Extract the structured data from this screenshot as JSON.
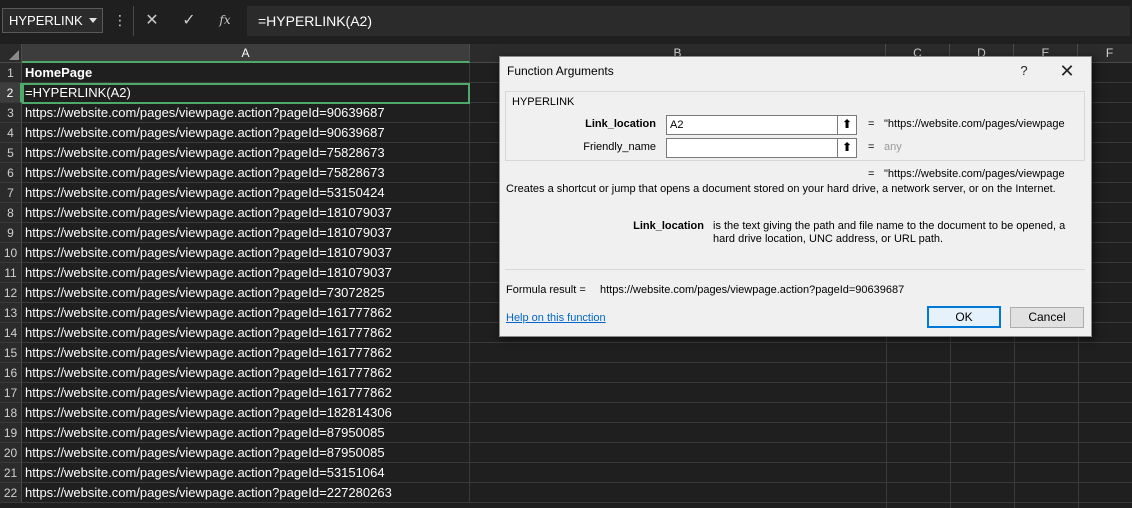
{
  "formula_bar": {
    "name_box": "HYPERLINK",
    "cancel_icon": "✕",
    "enter_icon": "✓",
    "fx_label": "fx",
    "formula": "=HYPERLINK(A2)"
  },
  "columns": [
    "A",
    "B",
    "C",
    "D",
    "E",
    "F"
  ],
  "rows": [
    {
      "num": "1",
      "a": "HomePage"
    },
    {
      "num": "2",
      "a": "=HYPERLINK(A2)"
    },
    {
      "num": "3",
      "a": "https://website.com/pages/viewpage.action?pageId=90639687"
    },
    {
      "num": "4",
      "a": "https://website.com/pages/viewpage.action?pageId=90639687"
    },
    {
      "num": "5",
      "a": "https://website.com/pages/viewpage.action?pageId=75828673"
    },
    {
      "num": "6",
      "a": "https://website.com/pages/viewpage.action?pageId=75828673"
    },
    {
      "num": "7",
      "a": "https://website.com/pages/viewpage.action?pageId=53150424"
    },
    {
      "num": "8",
      "a": "https://website.com/pages/viewpage.action?pageId=181079037"
    },
    {
      "num": "9",
      "a": "https://website.com/pages/viewpage.action?pageId=181079037"
    },
    {
      "num": "10",
      "a": "https://website.com/pages/viewpage.action?pageId=181079037"
    },
    {
      "num": "11",
      "a": "https://website.com/pages/viewpage.action?pageId=181079037"
    },
    {
      "num": "12",
      "a": "https://website.com/pages/viewpage.action?pageId=73072825"
    },
    {
      "num": "13",
      "a": "https://website.com/pages/viewpage.action?pageId=161777862"
    },
    {
      "num": "14",
      "a": "https://website.com/pages/viewpage.action?pageId=161777862"
    },
    {
      "num": "15",
      "a": "https://website.com/pages/viewpage.action?pageId=161777862"
    },
    {
      "num": "16",
      "a": "https://website.com/pages/viewpage.action?pageId=161777862"
    },
    {
      "num": "17",
      "a": "https://website.com/pages/viewpage.action?pageId=161777862"
    },
    {
      "num": "18",
      "a": "https://website.com/pages/viewpage.action?pageId=182814306"
    },
    {
      "num": "19",
      "a": "https://website.com/pages/viewpage.action?pageId=87950085"
    },
    {
      "num": "20",
      "a": "https://website.com/pages/viewpage.action?pageId=87950085"
    },
    {
      "num": "21",
      "a": "https://website.com/pages/viewpage.action?pageId=53151064"
    },
    {
      "num": "22",
      "a": "https://website.com/pages/viewpage.action?pageId=227280263"
    }
  ],
  "dialog": {
    "title": "Function Arguments",
    "help_icon": "?",
    "close_icon": "✕",
    "function_name": "HYPERLINK",
    "args": [
      {
        "label": "Link_location",
        "value": "A2",
        "eq": "=",
        "result": "\"https://website.com/pages/viewpage"
      },
      {
        "label": "Friendly_name",
        "value": "",
        "eq": "=",
        "result": "any"
      }
    ],
    "ref_icon": "⬆",
    "result_eq": "=",
    "result_preview": "\"https://website.com/pages/viewpage",
    "description": "Creates a shortcut or jump that opens a document stored on your hard drive, a network server, or on the Internet.",
    "arg_help_name": "Link_location",
    "arg_help_text": "is the text giving the path and file name to the document to be opened, a hard drive location, UNC address, or URL path.",
    "formula_result_label": "Formula result =",
    "formula_result_value": "https://website.com/pages/viewpage.action?pageId=90639687",
    "help_link": "Help on this function",
    "ok": "OK",
    "cancel": "Cancel"
  }
}
